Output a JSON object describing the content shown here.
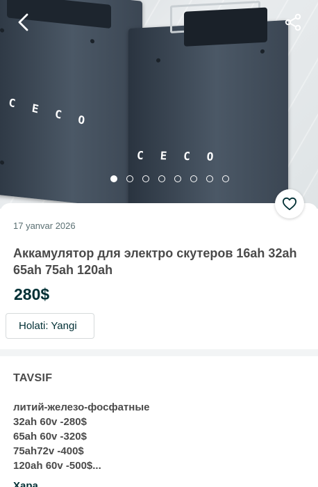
{
  "photo": {
    "brand_text": "CECO",
    "dots_total": 8,
    "dots_active_index": 0
  },
  "icons": {
    "back": "chevron-left-icon",
    "share": "share-icon",
    "favorite": "heart-icon"
  },
  "listing": {
    "date": "17 yanvar 2026",
    "title": "Аккамулятор для электро скутеров 16ah 32ah 65ah 75ah 120ah",
    "price": "280$",
    "condition": "Holati: Yangi"
  },
  "description": {
    "heading": "TAVSIF",
    "lines": [
      "литий-железо-фосфатные",
      "32ah 60v -280$",
      "65ah 60v -320$",
      "75ah72v -400$",
      "120ah 60v -500$..."
    ],
    "more_label": "Ҳара"
  },
  "colors": {
    "text_primary": "#002f34",
    "text_secondary": "#5a6f72"
  }
}
